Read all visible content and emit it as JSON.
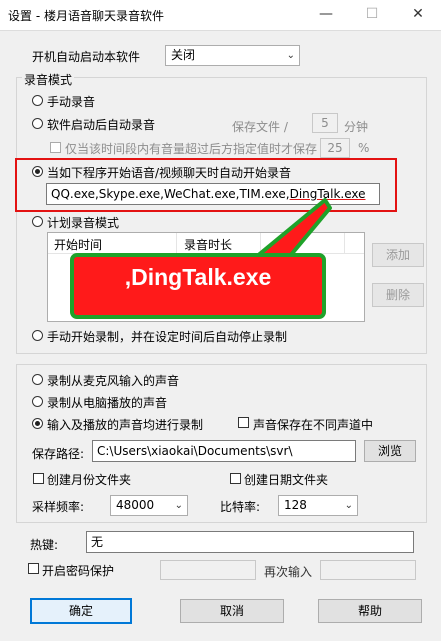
{
  "window": {
    "title": "设置 - 楼月语音聊天录音软件",
    "controls": {
      "minimize": "—",
      "maximize": "☐",
      "close": "✕"
    }
  },
  "autostart": {
    "label": "开机自动启动本软件",
    "value": "关闭"
  },
  "record_mode": {
    "group_label": "录音模式",
    "manual": "手动录音",
    "auto_after_start": "软件启动后自动录音",
    "save_every_label": "保存文件 /",
    "save_every_value": "5",
    "save_every_unit": "分钟",
    "threshold_label": "仅当该时间段内有音量超过后方指定值时才保存",
    "threshold_value": "25",
    "threshold_unit": "%",
    "program_start": "当如下程序开始语音/视频聊天时自动开始录音",
    "program_list": "QQ.exe,Skype.exe,WeChat.exe,TIM.exe,DingTalk.exe",
    "program_list_prefix": "QQ.exe,Skype.exe,WeChat.exe,TIM.exe,",
    "program_list_highlight": "DingTalk.exe",
    "scheduled": "计划录音模式",
    "schedule_headers": [
      "开始时间",
      "录音时长"
    ],
    "add_button": "添加",
    "delete_button": "删除",
    "manual_start_timed_stop": "手动开始录制，并在设定时间后自动停止录制"
  },
  "callout": {
    "text": ",DingTalk.exe",
    "color": "#ff1a1a",
    "border_color": "#1fa22a"
  },
  "source": {
    "mic": "录制从麦克风输入的声音",
    "speaker": "录制从电脑播放的声音",
    "both": "输入及播放的声音均进行录制",
    "separate_channels": "声音保存在不同声道中",
    "path_label": "保存路径:",
    "path_value": "C:\\Users\\xiaokai\\Documents\\svr\\",
    "browse_button": "浏览",
    "month_folder": "创建月份文件夹",
    "date_folder": "创建日期文件夹",
    "sample_rate_label": "采样频率:",
    "sample_rate_value": "48000",
    "bitrate_label": "比特率:",
    "bitrate_value": "128"
  },
  "hotkey": {
    "label": "热键:",
    "value": "无"
  },
  "password": {
    "label": "开启密码保护",
    "repeat_label": "再次输入"
  },
  "footer": {
    "ok": "确定",
    "cancel": "取消",
    "help": "帮助"
  }
}
